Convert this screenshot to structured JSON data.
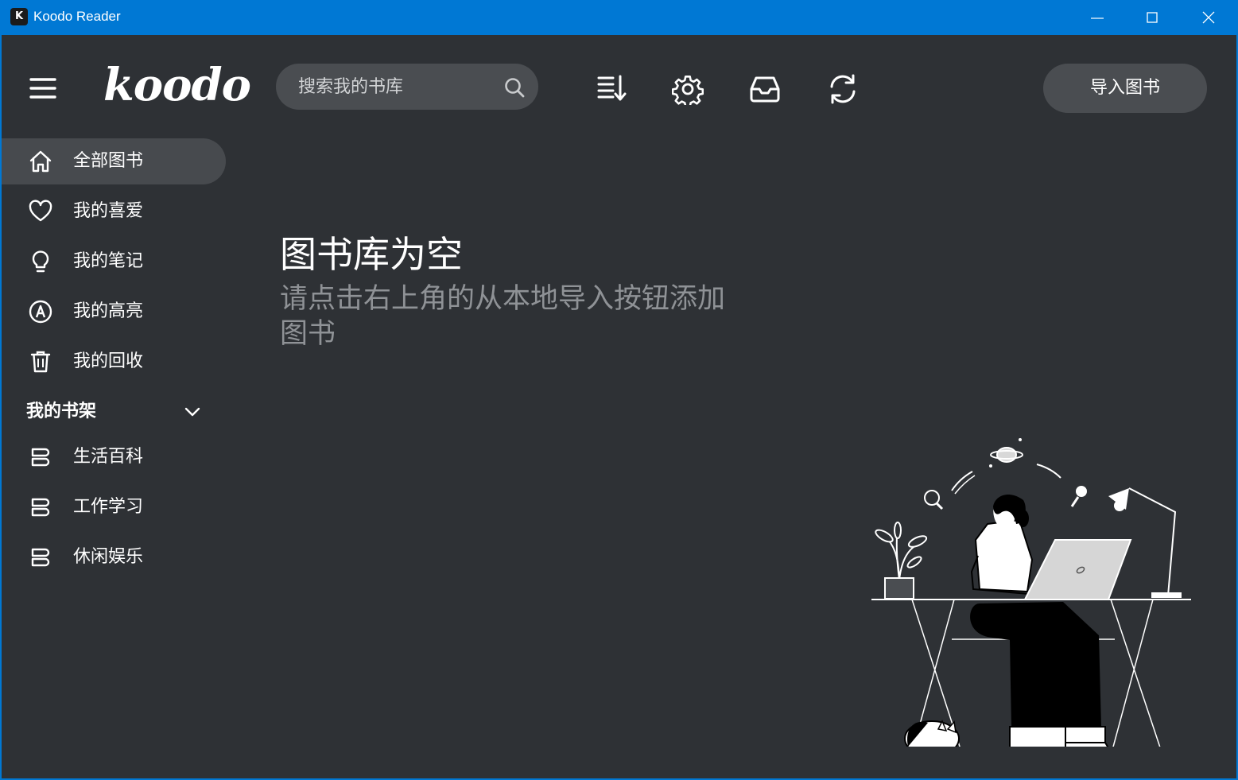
{
  "window": {
    "title": "Koodo Reader",
    "icon_letter": "K",
    "controls": [
      "minimize-icon",
      "maximize-icon",
      "close-icon"
    ]
  },
  "header": {
    "logo": "koodo",
    "search": {
      "placeholder": "搜索我的书库",
      "value": ""
    },
    "tools": [
      "sort-icon",
      "gear-icon",
      "inbox-icon",
      "sync-icon"
    ],
    "import_label": "导入图书"
  },
  "sidebar": {
    "items": [
      {
        "label": "全部图书",
        "icon": "home-icon",
        "active": true
      },
      {
        "label": "我的喜爱",
        "icon": "heart-icon",
        "active": false
      },
      {
        "label": "我的笔记",
        "icon": "lightbulb-icon",
        "active": false
      },
      {
        "label": "我的高亮",
        "icon": "highlighter-icon",
        "active": false
      },
      {
        "label": "我的回收",
        "icon": "trash-icon",
        "active": false
      }
    ],
    "shelf_title": "我的书架",
    "shelves": [
      {
        "label": "生活百科",
        "icon": "shelf-icon"
      },
      {
        "label": "工作学习",
        "icon": "shelf-icon"
      },
      {
        "label": "休闲娱乐",
        "icon": "shelf-icon"
      }
    ]
  },
  "main": {
    "empty_title": "图书库为空",
    "empty_subtitle": "请点击右上角的从本地导入按钮添加图书"
  },
  "colors": {
    "titlebar": "#0078d4",
    "background": "#2e3135",
    "active_item": "#474a4e",
    "button": "#4a4d51",
    "muted_text": "#8f9296"
  }
}
